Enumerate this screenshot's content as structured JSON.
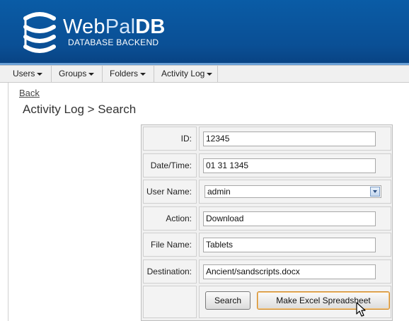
{
  "header": {
    "brand_web": "Web",
    "brand_pal": "Pal",
    "brand_db": "DB",
    "subtitle": "DATABASE BACKEND"
  },
  "nav": {
    "items": [
      {
        "label": "Users"
      },
      {
        "label": "Groups"
      },
      {
        "label": "Folders"
      },
      {
        "label": "Activity Log"
      }
    ]
  },
  "page": {
    "back_label": "Back",
    "title": "Activity Log > Search"
  },
  "form": {
    "id": {
      "label": "ID:",
      "value": "12345"
    },
    "datetime": {
      "label": "Date/Time:",
      "value": "01 31 1345"
    },
    "username": {
      "label": "User Name:",
      "value": "admin"
    },
    "action": {
      "label": "Action:",
      "value": "Download"
    },
    "filename": {
      "label": "File Name:",
      "value": "Tablets"
    },
    "destination": {
      "label": "Destination:",
      "value": "Ancient/sandscripts.docx"
    },
    "search_label": "Search",
    "excel_label": "Make Excel Spreadsheet"
  },
  "colors": {
    "header_blue": "#0a5ca6",
    "focus_orange": "#d08a2a"
  }
}
